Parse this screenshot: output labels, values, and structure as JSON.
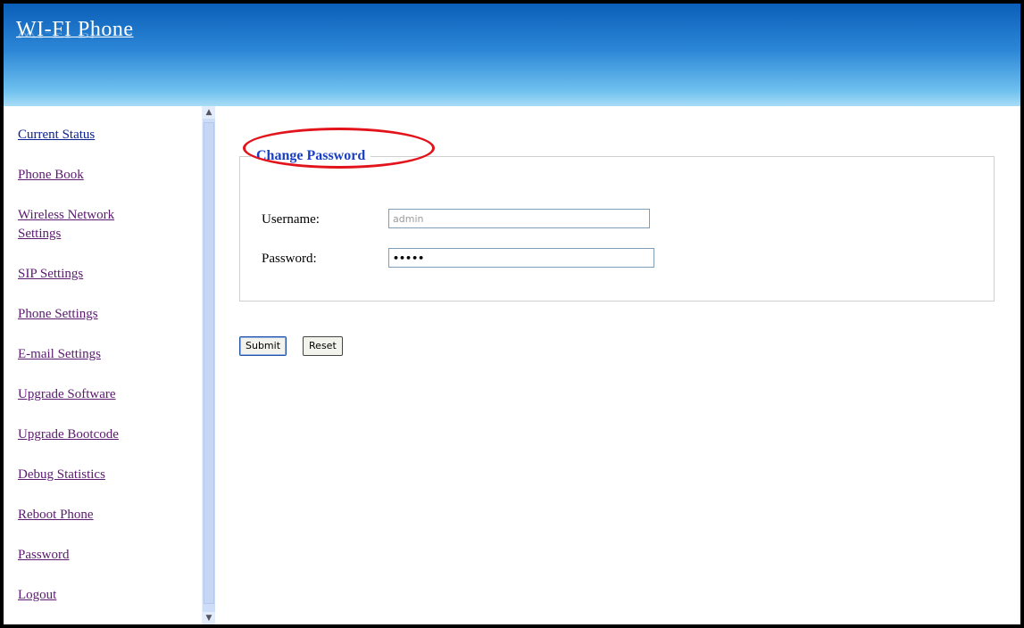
{
  "header": {
    "title": "WI-FI Phone"
  },
  "sidebar": {
    "items": [
      {
        "label": "Current Status"
      },
      {
        "label": "Phone Book"
      },
      {
        "label": "Wireless Network Settings"
      },
      {
        "label": "SIP Settings"
      },
      {
        "label": "Phone Settings"
      },
      {
        "label": "E-mail Settings"
      },
      {
        "label": "Upgrade Software"
      },
      {
        "label": "Upgrade Bootcode"
      },
      {
        "label": "Debug Statistics"
      },
      {
        "label": "Reboot Phone"
      },
      {
        "label": "Password"
      },
      {
        "label": "Logout"
      }
    ]
  },
  "main": {
    "section_title": "Change Password",
    "username_label": "Username:",
    "username_value": "admin",
    "password_label": "Password:",
    "password_value": "•••••",
    "submit_label": "Submit",
    "reset_label": "Reset"
  },
  "colors": {
    "header_top": "#0a5fb8",
    "header_bottom": "#a8dcf6",
    "link": "#0a1f8f",
    "section_title": "#1a3fc0",
    "highlight_ellipse": "#e2131b"
  },
  "icons": {
    "scroll_up": "chevron-up-icon",
    "scroll_down": "chevron-down-icon"
  }
}
